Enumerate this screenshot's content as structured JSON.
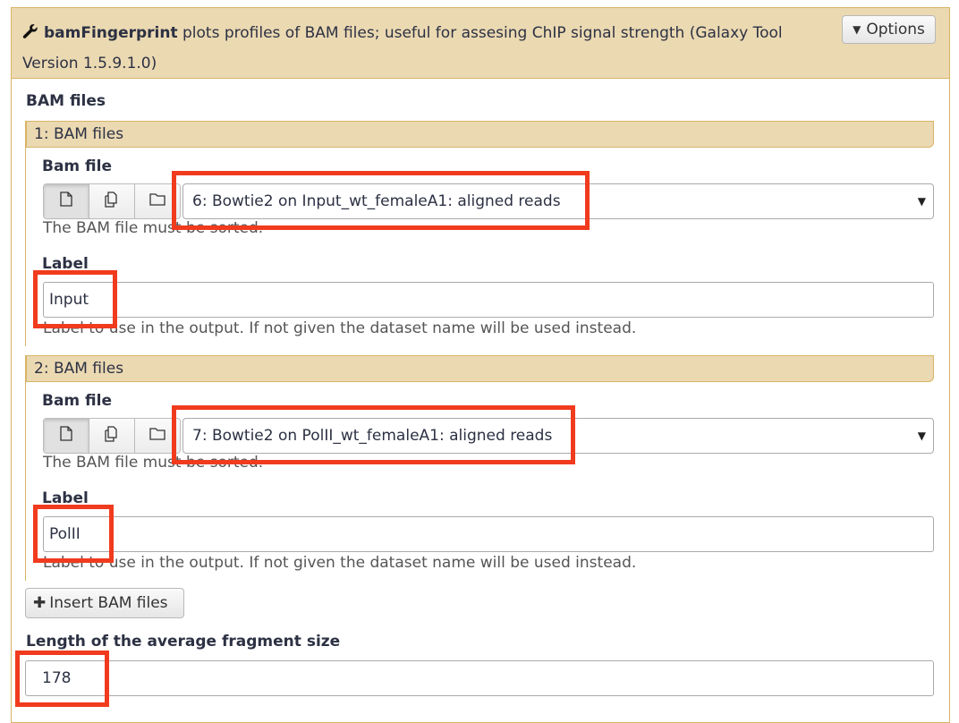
{
  "tool": {
    "name": "bamFingerprint",
    "description": " plots profiles of BAM files; useful for assesing ChIP signal strength (Galaxy Tool Version 1.5.9.1.0)",
    "options_label": "Options"
  },
  "section_label": "BAM files",
  "repeats": [
    {
      "header": "1: BAM files",
      "bam_label": "Bam file",
      "selected": "6: Bowtie2 on Input_wt_femaleA1: aligned reads",
      "bam_help": "The BAM file must be sorted.",
      "label_label": "Label",
      "label_value": "Input",
      "label_help": "Label to use in the output. If not given the dataset name will be used instead."
    },
    {
      "header": "2: BAM files",
      "bam_label": "Bam file",
      "selected": "7: Bowtie2 on PolII_wt_femaleA1: aligned reads",
      "bam_help": "The BAM file must be sorted.",
      "label_label": "Label",
      "label_value": "PolII",
      "label_help": "Label to use in the output. If not given the dataset name will be used instead."
    }
  ],
  "insert_button": "Insert BAM files",
  "fragment": {
    "label": "Length of the average fragment size",
    "value": "178"
  },
  "icons": [
    "wrench-icon",
    "caret-down-icon",
    "file-icon",
    "files-icon",
    "folder-icon",
    "plus-icon"
  ],
  "colors": {
    "header_bg": "#ebd9b2",
    "border": "#d8b365",
    "highlight": "#f13b1e"
  }
}
